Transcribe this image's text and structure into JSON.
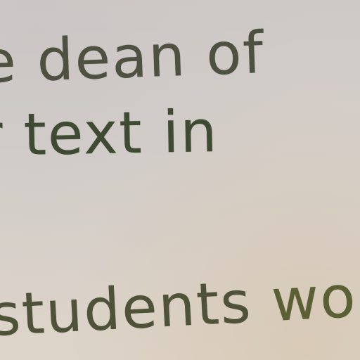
{
  "handwriting": {
    "line1": "e dean of",
    "line2": "r text in",
    "line3_word1": "students",
    "line3_word2": "would"
  },
  "colors": {
    "paper": "#d6d0cb",
    "ink": "#4e5041"
  }
}
